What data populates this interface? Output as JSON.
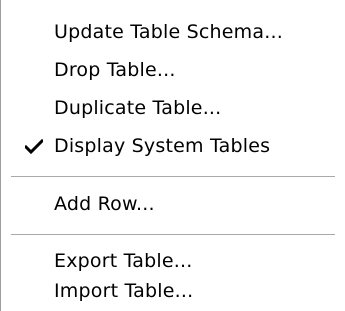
{
  "context_menu": {
    "items": [
      {
        "label": "Update Table Schema...",
        "checked": false
      },
      {
        "label": "Drop Table...",
        "checked": false
      },
      {
        "label": "Duplicate Table...",
        "checked": false
      },
      {
        "label": "Display System Tables",
        "checked": true
      },
      {
        "label": "Add Row...",
        "checked": false
      },
      {
        "label": "Export Table...",
        "checked": false
      },
      {
        "label": "Import Table...",
        "checked": false
      }
    ],
    "check_icon": "checkmark-icon"
  }
}
